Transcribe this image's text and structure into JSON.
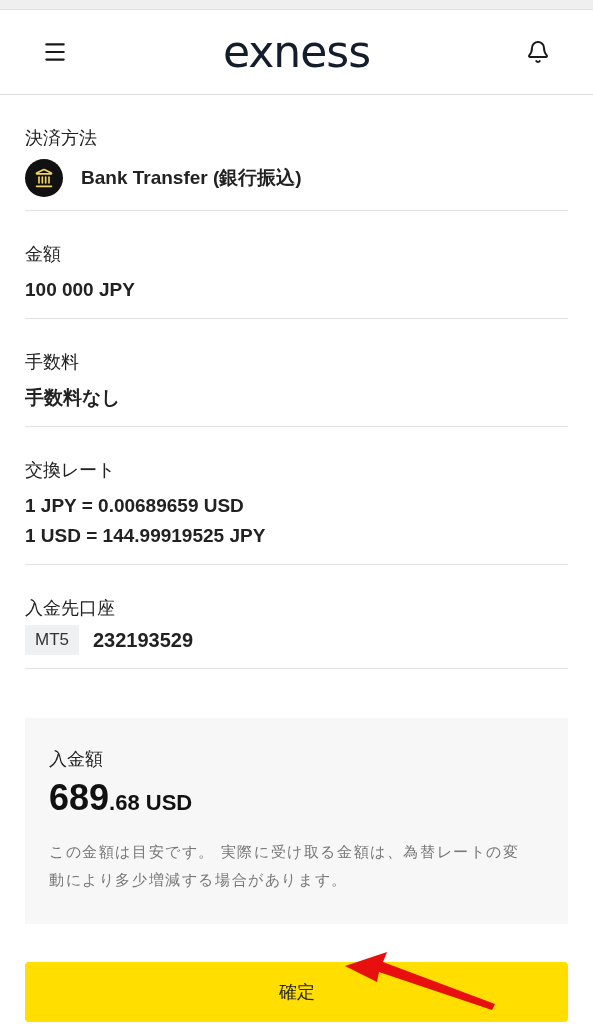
{
  "header": {
    "logo": "exness"
  },
  "details": [
    {
      "kind": "method",
      "label": "決済方法",
      "values": [
        "Bank Transfer (銀行振込)"
      ]
    },
    {
      "kind": "text",
      "label": "金額",
      "values": [
        "100 000 JPY"
      ]
    },
    {
      "kind": "text",
      "label": "手数料",
      "values": [
        "手数料なし"
      ]
    },
    {
      "kind": "text",
      "label": "交換レート",
      "values": [
        "1 JPY = 0.00689659 USD",
        "1 USD = 144.99919525 JPY"
      ]
    },
    {
      "kind": "account",
      "label": "入金先口座",
      "tag": "MT5",
      "values": [
        "232193529"
      ]
    }
  ],
  "summary": {
    "label": "入金額",
    "amount_whole": "689",
    "amount_rest": ".68 USD",
    "note": "この金額は目安です。 実際に受け取る金額は、為替レートの変動により多少増減する場合があります。"
  },
  "confirm_button": "確定"
}
